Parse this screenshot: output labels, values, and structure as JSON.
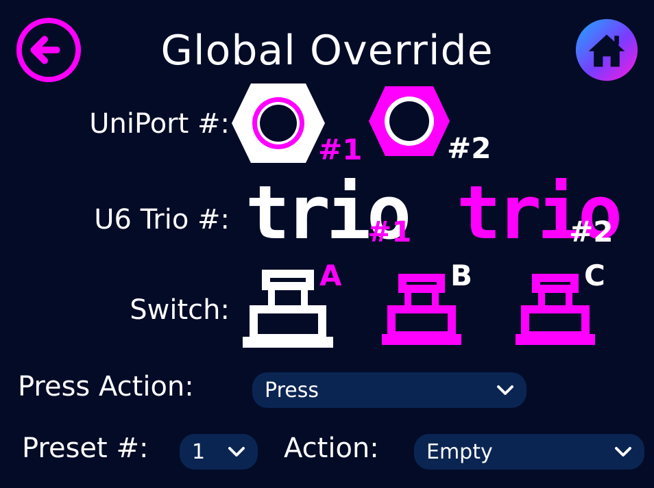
{
  "header": {
    "title": "Global Override",
    "back_icon": "back-arrow-icon",
    "home_icon": "home-icon"
  },
  "uniport": {
    "label": "UniPort #:",
    "options": [
      {
        "number": "#1",
        "selected": true
      },
      {
        "number": "#2",
        "selected": false
      }
    ]
  },
  "trio": {
    "label": "U6 Trio #:",
    "options": [
      {
        "text": "trio",
        "number": "#1",
        "selected": true
      },
      {
        "text": "trio",
        "number": "#2",
        "selected": false
      }
    ]
  },
  "switch": {
    "label": "Switch:",
    "options": [
      {
        "letter": "A",
        "selected": true
      },
      {
        "letter": "B",
        "selected": false
      },
      {
        "letter": "C",
        "selected": false
      }
    ]
  },
  "press_action": {
    "label": "Press Action:",
    "value": "Press"
  },
  "preset": {
    "label": "Preset #:",
    "value": "1"
  },
  "action": {
    "label": "Action:",
    "value": "Empty"
  },
  "colors": {
    "background": "#030b27",
    "accent": "#ff00ff",
    "selected": "#ffffff",
    "select_bg": "#0b2553"
  }
}
